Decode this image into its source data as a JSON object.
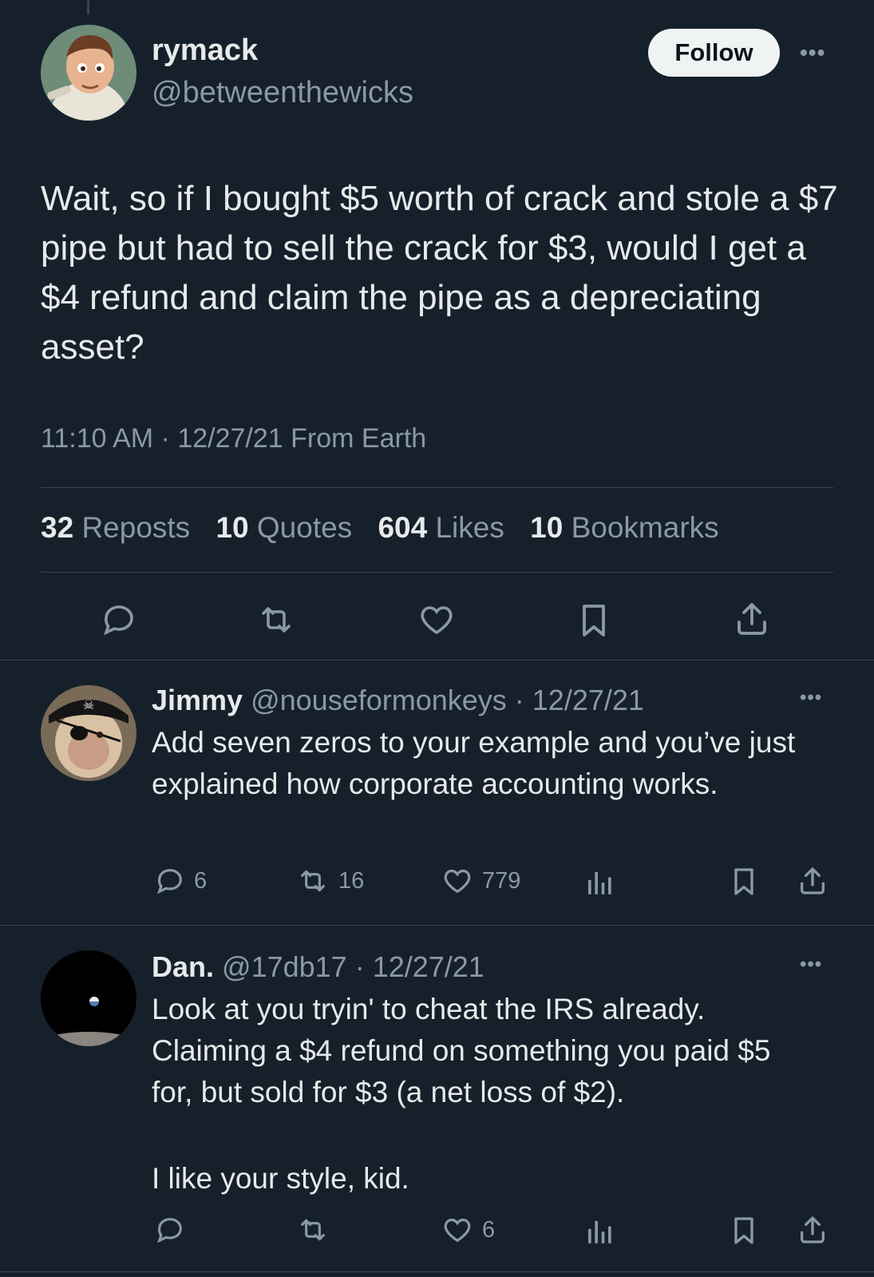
{
  "main_tweet": {
    "author_name": "rymack",
    "author_handle": "@betweenthewicks",
    "follow_label": "Follow",
    "more_label": "•••",
    "text": "Wait, so if I bought $5 worth of crack and stole a $7 pipe but had to sell the crack for $3, would I get a $4 refund and claim the pipe as a depreciating asset?",
    "timestamp": "11:10 AM · 12/27/21 From Earth",
    "stats": {
      "reposts_count": "32",
      "reposts_label": "Reposts",
      "quotes_count": "10",
      "quotes_label": "Quotes",
      "likes_count": "604",
      "likes_label": "Likes",
      "bookmarks_count": "10",
      "bookmarks_label": "Bookmarks"
    },
    "actions": [
      "reply-icon",
      "repost-icon",
      "like-icon",
      "bookmark-icon",
      "share-icon"
    ]
  },
  "replies": [
    {
      "name": "Jimmy",
      "handle": "@nouseformonkeys · 12/27/21",
      "text": "Add seven zeros to your example and you’ve just explained how corporate accounting works.",
      "more_label": "•••",
      "reply_count": "6",
      "repost_count": "16",
      "like_count": "779"
    },
    {
      "name": "Dan.",
      "handle": "@17db17 · 12/27/21",
      "text_line1": "Look at you tryin' to cheat the IRS already. Claiming a $4 refund on something you paid $5 for, but sold for $3 (a net loss of $2).",
      "text_line2": "I like your style, kid.",
      "more_label": "•••",
      "like_count": "6"
    }
  ],
  "colors": {
    "background": "#15202b",
    "text": "#e7e9ea",
    "secondary": "#8b98a5",
    "divider": "#38444d"
  }
}
